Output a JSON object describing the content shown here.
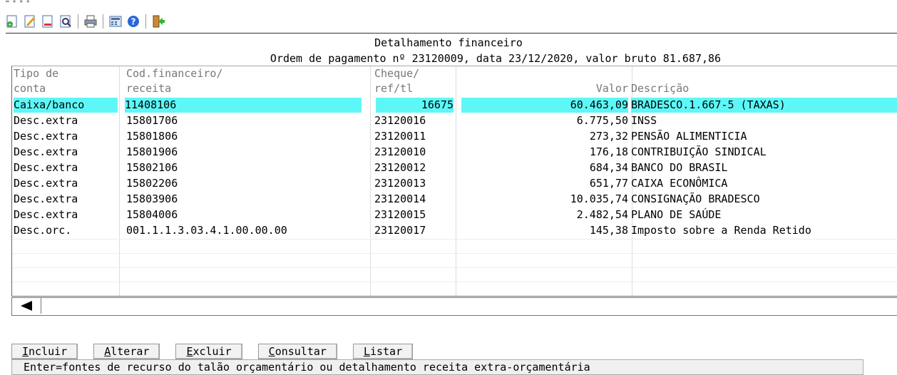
{
  "window": {
    "title": "Detalhamento financeiro",
    "subtitle": "Ordem de pagamento nº 23120009, data 23/12/2020, valor bruto 81.687,86"
  },
  "toolbar": {
    "icons": [
      "new-document-icon",
      "edit-document-icon",
      "blank-document-icon",
      "preview-icon",
      "print-icon",
      "calculator-icon",
      "help-icon",
      "exit-icon"
    ]
  },
  "table": {
    "headers": {
      "tipo_1": "Tipo de",
      "tipo_2": "conta",
      "cod_1": "Cod.financeiro/",
      "cod_2": "receita",
      "cheque_1": "Cheque/",
      "cheque_2": "ref/tl",
      "valor": "Valor",
      "descricao": "Descrição"
    },
    "rows": [
      {
        "tipo": "Caixa/banco",
        "cod": "11408106",
        "cheque": "16675",
        "valor": "60.463,09",
        "descricao": "BRADESCO.1.667-5 (TAXAS)"
      },
      {
        "tipo": "Desc.extra",
        "cod": "15801706",
        "cheque": "23120016",
        "valor": "6.775,50",
        "descricao": "INSS"
      },
      {
        "tipo": "Desc.extra",
        "cod": "15801806",
        "cheque": "23120011",
        "valor": "273,32",
        "descricao": "PENSÃO ALIMENTICIA"
      },
      {
        "tipo": "Desc.extra",
        "cod": "15801906",
        "cheque": "23120010",
        "valor": "176,18",
        "descricao": "CONTRIBUIÇÃO SINDICAL"
      },
      {
        "tipo": "Desc.extra",
        "cod": "15802106",
        "cheque": "23120012",
        "valor": "684,34",
        "descricao": "BANCO DO BRASIL"
      },
      {
        "tipo": "Desc.extra",
        "cod": "15802206",
        "cheque": "23120013",
        "valor": "651,77",
        "descricao": "CAIXA ECONÔMICA"
      },
      {
        "tipo": "Desc.extra",
        "cod": "15803906",
        "cheque": "23120014",
        "valor": "10.035,74",
        "descricao": "CONSIGNAÇÃO BRADESCO"
      },
      {
        "tipo": "Desc.extra",
        "cod": "15804006",
        "cheque": "23120015",
        "valor": "2.482,54",
        "descricao": "PLANO DE SAÚDE"
      },
      {
        "tipo": "Desc.orc.",
        "cod": "001.1.1.3.03.4.1.00.00.00",
        "cheque": "23120017",
        "valor": "145,38",
        "descricao": "Imposto sobre a Renda Retido"
      }
    ]
  },
  "buttons": {
    "incluir_key": "I",
    "incluir_rest": "ncluir",
    "alterar_key": "A",
    "alterar_rest": "lterar",
    "excluir_key": "E",
    "excluir_rest": "xcluir",
    "consultar_key": "C",
    "consultar_rest": "onsultar",
    "listar_key": "L",
    "listar_rest": "istar"
  },
  "status": "Enter=fontes de recurso do talão orçamentário ou detalhamento receita extra-orçamentária",
  "colors": {
    "selection": "#5ef7f7"
  }
}
